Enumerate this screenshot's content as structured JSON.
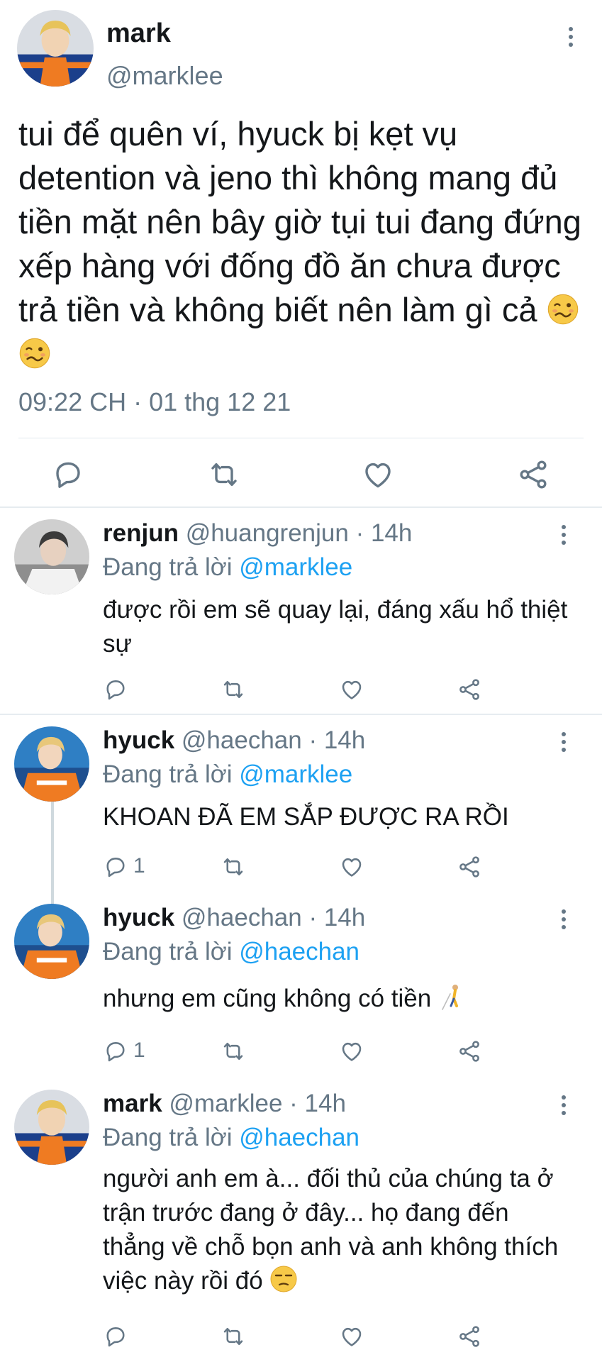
{
  "main_tweet": {
    "name": "mark",
    "handle": "@marklee",
    "text": "tui để quên ví, hyuck bị kẹt vụ detention và jeno thì không mang đủ tiền mặt nên bây giờ tụi tui đang đứng xếp hàng với đống đồ ăn chưa được trả tiền và không biết nên làm gì cả",
    "emojis": [
      "woozy-face-emoji",
      "woozy-face-emoji"
    ],
    "timestamp": "09:22 CH · 01 thg 12 21",
    "actions": [
      "reply-icon",
      "retweet-icon",
      "like-icon",
      "share-icon"
    ]
  },
  "replies": [
    {
      "name": "renjun",
      "handle": "@huangrenjun",
      "time": "· 14h",
      "replying_prefix": "Đang trả lời",
      "replying_to": "@marklee",
      "text": "được rồi em sẽ quay lại, đáng xấu hổ thiệt sự",
      "reply_count": ""
    },
    {
      "name": "hyuck",
      "handle": "@haechan",
      "time": "· 14h",
      "replying_prefix": "Đang trả lời",
      "replying_to": "@marklee",
      "text": "KHOAN ĐÃ EM SẮP ĐƯỢC RA RỒI",
      "reply_count": "1"
    },
    {
      "name": "hyuck",
      "handle": "@haechan",
      "time": "· 14h",
      "replying_prefix": "Đang trả lời",
      "replying_to": "@haechan",
      "text": "nhưng em cũng không có tiền",
      "emoji": "person-with-cane-emoji",
      "reply_count": "1"
    },
    {
      "name": "mark",
      "handle": "@marklee",
      "time": "· 14h",
      "replying_prefix": "Đang trả lời",
      "replying_to": "@haechan",
      "text": "người anh em à... đối thủ của chúng ta ở trận trước đang ở đây... họ đang đến thẳng về chỗ bọn anh và anh không thích việc này rồi đó",
      "emoji": "unamused-face-emoji",
      "reply_count": ""
    }
  ],
  "colors": {
    "text": "#14171a",
    "secondary": "#657786",
    "link": "#1da1f2",
    "divider": "#e1e8ed"
  }
}
